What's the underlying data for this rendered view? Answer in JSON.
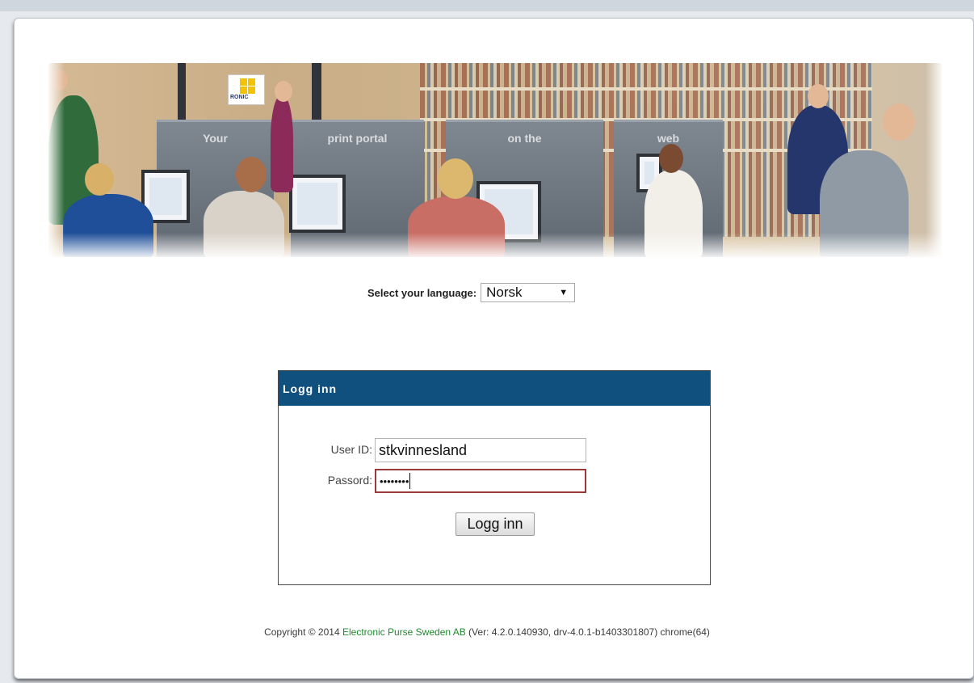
{
  "banner": {
    "panels": [
      "Your",
      "print portal",
      "on the",
      "web"
    ],
    "logo_text": "RONIC"
  },
  "language": {
    "label": "Select your language:",
    "selected": "Norsk"
  },
  "login": {
    "header": "Logg inn",
    "user_id_label": "User ID:",
    "user_id_value": "stkvinnesland",
    "password_label": "Passord:",
    "password_value": "••••••••",
    "submit_label": "Logg inn"
  },
  "footer": {
    "prefix": "Copyright © 2014 ",
    "company": "Electronic Purse Sweden AB",
    "suffix": " (Ver: 4.2.0.140930, drv-4.0.1-b1403301807) chrome(64)"
  },
  "colors": {
    "header_bg": "#10507f",
    "link_green": "#1f8a2e",
    "focus_border": "#9b3a3a"
  },
  "icons": {
    "dropdown": "chevron-down-icon"
  }
}
